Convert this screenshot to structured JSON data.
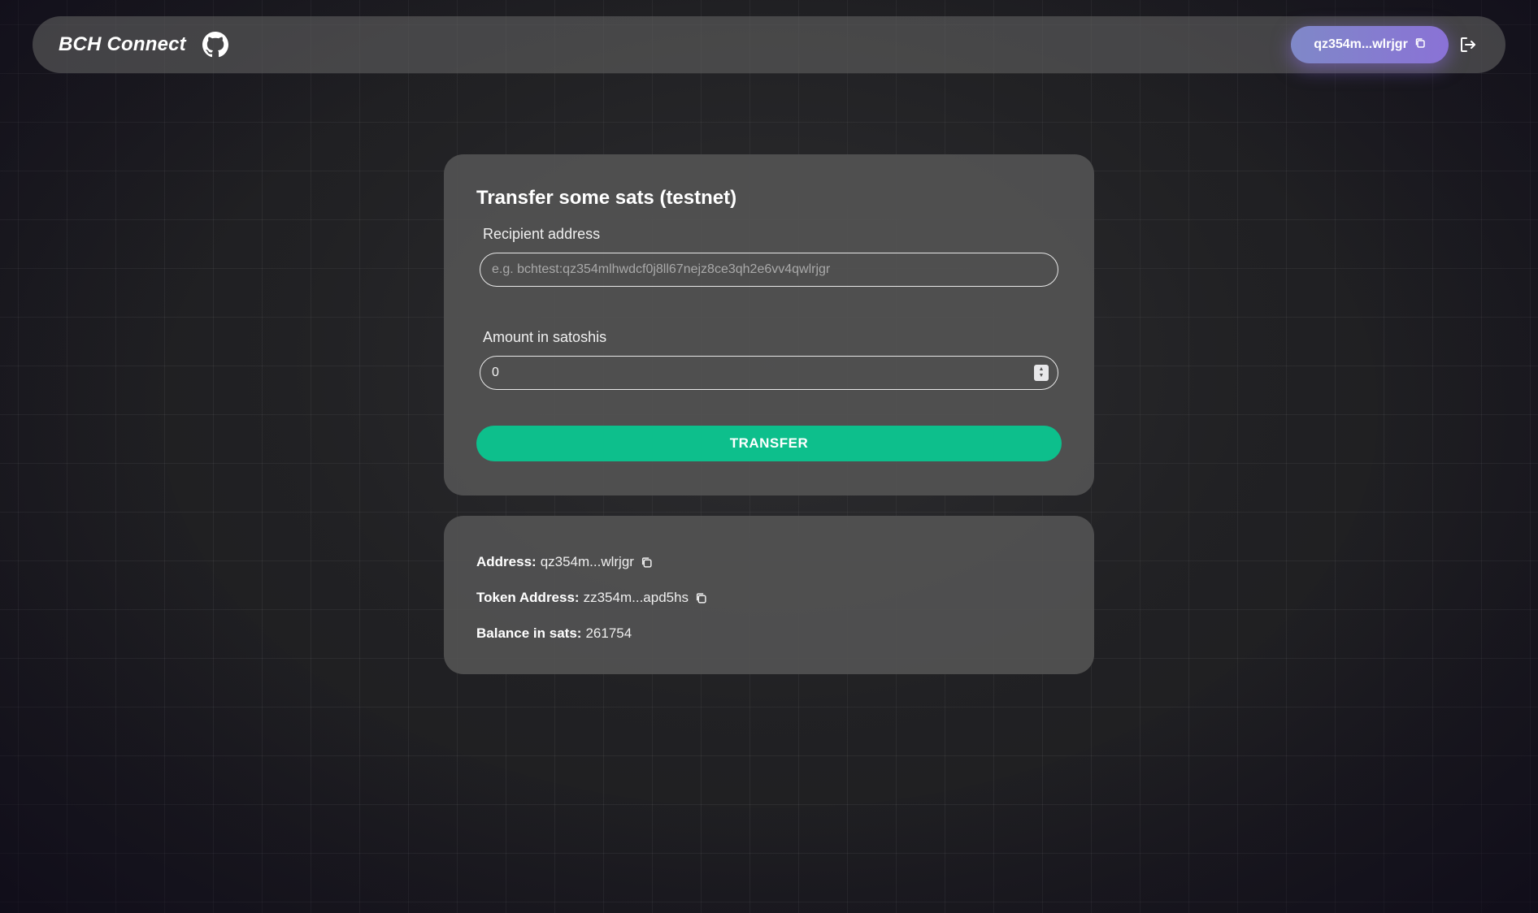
{
  "header": {
    "brand": "BCH Connect",
    "github_icon": "github-icon",
    "address_short": "qz354m...wlrjgr",
    "copy_icon": "copy-icon",
    "logout_icon": "logout-icon",
    "accent_gradient": [
      "#7f88c8",
      "#8a72d6"
    ]
  },
  "transfer": {
    "title": "Transfer some sats (testnet)",
    "recipient_label": "Recipient address",
    "recipient_placeholder": "e.g. bchtest:qz354mlhwdcf0j8ll67nejz8ce3qh2e6vv4qwlrjgr",
    "recipient_value": "",
    "amount_label": "Amount in satoshis",
    "amount_value": "0",
    "button_label": "TRANSFER",
    "button_color": "#0dbf8c"
  },
  "wallet": {
    "address_label": "Address:",
    "address_value": "qz354m...wlrjgr",
    "token_address_label": "Token Address:",
    "token_address_value": "zz354m...apd5hs",
    "balance_label": "Balance in sats:",
    "balance_value": "261754"
  }
}
